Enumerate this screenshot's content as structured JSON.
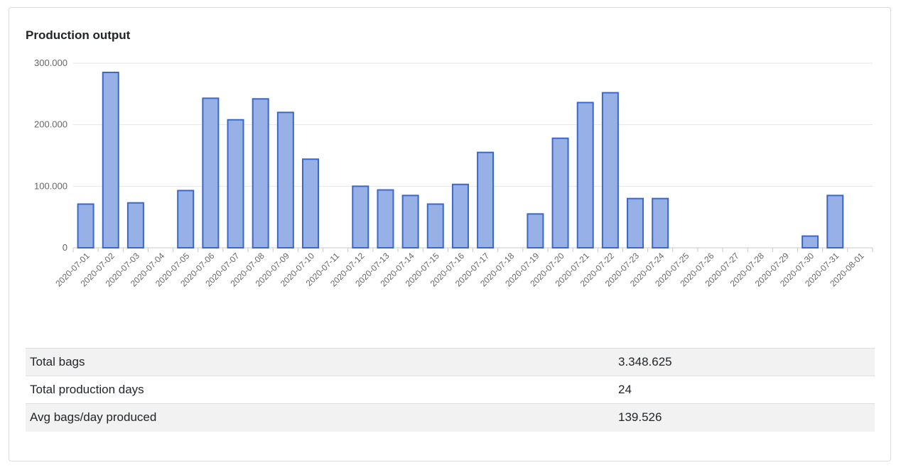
{
  "title": "Production output",
  "chart_data": {
    "type": "bar",
    "categories": [
      "2020-07-01",
      "2020-07-02",
      "2020-07-03",
      "2020-07-04",
      "2020-07-05",
      "2020-07-06",
      "2020-07-07",
      "2020-07-08",
      "2020-07-09",
      "2020-07-10",
      "2020-07-11",
      "2020-07-12",
      "2020-07-13",
      "2020-07-14",
      "2020-07-15",
      "2020-07-16",
      "2020-07-17",
      "2020-07-18",
      "2020-07-19",
      "2020-07-20",
      "2020-07-21",
      "2020-07-22",
      "2020-07-23",
      "2020-07-24",
      "2020-07-25",
      "2020-07-26",
      "2020-07-27",
      "2020-07-28",
      "2020-07-29",
      "2020-07-30",
      "2020-07-31",
      "2020-08-01"
    ],
    "values": [
      71000,
      285000,
      73000,
      0,
      93000,
      243000,
      208000,
      242000,
      220000,
      144000,
      0,
      100000,
      94000,
      85000,
      71000,
      103000,
      155000,
      0,
      55000,
      178000,
      236000,
      252000,
      80000,
      80000,
      0,
      0,
      0,
      0,
      0,
      19000,
      85000,
      0
    ],
    "ylim": [
      0,
      300000
    ],
    "yticks": [
      0,
      100000,
      200000,
      300000
    ],
    "ytick_labels": [
      "0",
      "100.000",
      "200.000",
      "300.000"
    ],
    "grid": true,
    "colors": {
      "bar_fill": "#97b0e6",
      "bar_stroke": "#3a67c8",
      "grid": "#e6e6e6",
      "axis": "#c8c8c8",
      "tick_label": "#666666"
    }
  },
  "summary": [
    {
      "label": "Total bags",
      "value": "3.348.625"
    },
    {
      "label": "Total production days",
      "value": "24"
    },
    {
      "label": "Avg bags/day produced",
      "value": "139.526"
    }
  ]
}
